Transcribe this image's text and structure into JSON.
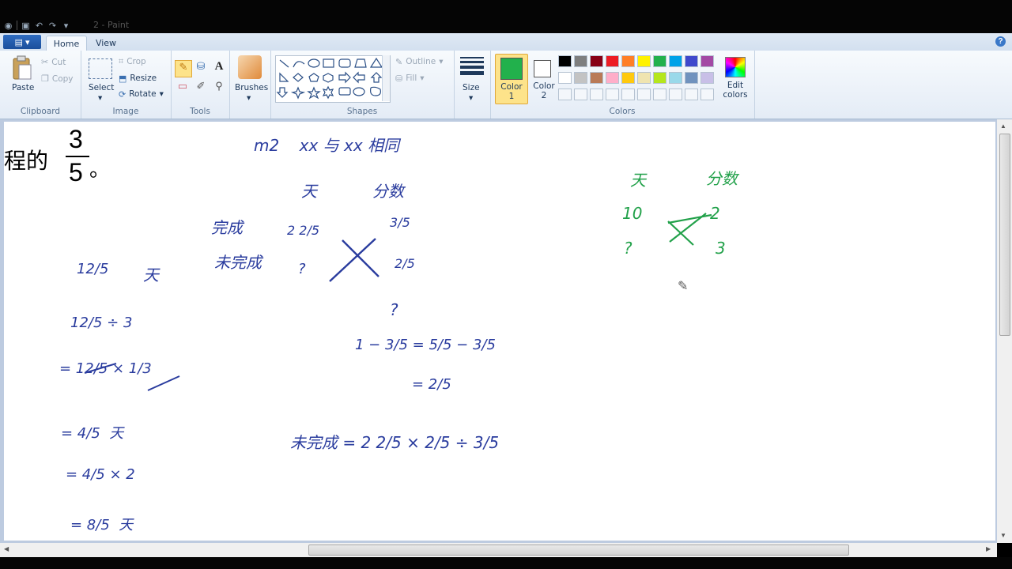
{
  "window": {
    "title": "2 - Paint"
  },
  "ribbon_tabs": [
    "Home",
    "View"
  ],
  "clipboard": {
    "paste": "Paste",
    "cut": "Cut",
    "copy": "Copy",
    "group": "Clipboard"
  },
  "image": {
    "select": "Select",
    "crop": "Crop",
    "resize": "Resize",
    "rotate": "Rotate",
    "group": "Image"
  },
  "tools": {
    "group": "Tools"
  },
  "brushes": {
    "label": "Brushes"
  },
  "shapes": {
    "outline": "Outline",
    "fill": "Fill",
    "group": "Shapes"
  },
  "size": {
    "label": "Size"
  },
  "colors": {
    "color1": "Color\n1",
    "color2": "Color\n2",
    "edit": "Edit\ncolors",
    "group": "Colors",
    "color1_value": "#22b14c",
    "color2_value": "#ffffff",
    "palette_row1": [
      "#000000",
      "#7f7f7f",
      "#880015",
      "#ed1c24",
      "#ff7f27",
      "#fff200",
      "#22b14c",
      "#00a2e8",
      "#3f48cc",
      "#a349a4"
    ],
    "palette_row2": [
      "#ffffff",
      "#c3c3c3",
      "#b97a57",
      "#ffaec9",
      "#ffc90e",
      "#efe4b0",
      "#b5e61d",
      "#99d9ea",
      "#7092be",
      "#c8bfe7"
    ]
  },
  "canvas_text": {
    "printed_prefix": "程的",
    "printed_num": "3",
    "printed_den": "5",
    "printed_suffix": "。",
    "top_note": "m2    xx 与 xx 相同",
    "left_label_a": "完成",
    "left_label_b": "未完成",
    "mid_header_a": "天",
    "mid_header_b": "分数",
    "l1a": "12/5",
    "l1b": "天",
    "l2": "12/5 ÷ 3",
    "l3": "= 12/5 × 1/3",
    "l4": "= 4/5  天",
    "l5": "= 4/5 × 2",
    "l6": "= 8/5  天",
    "cx_a": "2 2/5",
    "cx_b": "3/5",
    "cx_c": "?",
    "cx_d": "2/5",
    "calc_q": "?",
    "calc1": "1 − 3/5 = 5/5 − 3/5",
    "calc2": "= 2/5",
    "final": "未完成 = 2 2/5 × 2/5 ÷ 3/5",
    "right_a": "天",
    "right_b": "分数",
    "right_c": "10",
    "right_d": "2",
    "right_e": "?",
    "right_f": "3"
  }
}
